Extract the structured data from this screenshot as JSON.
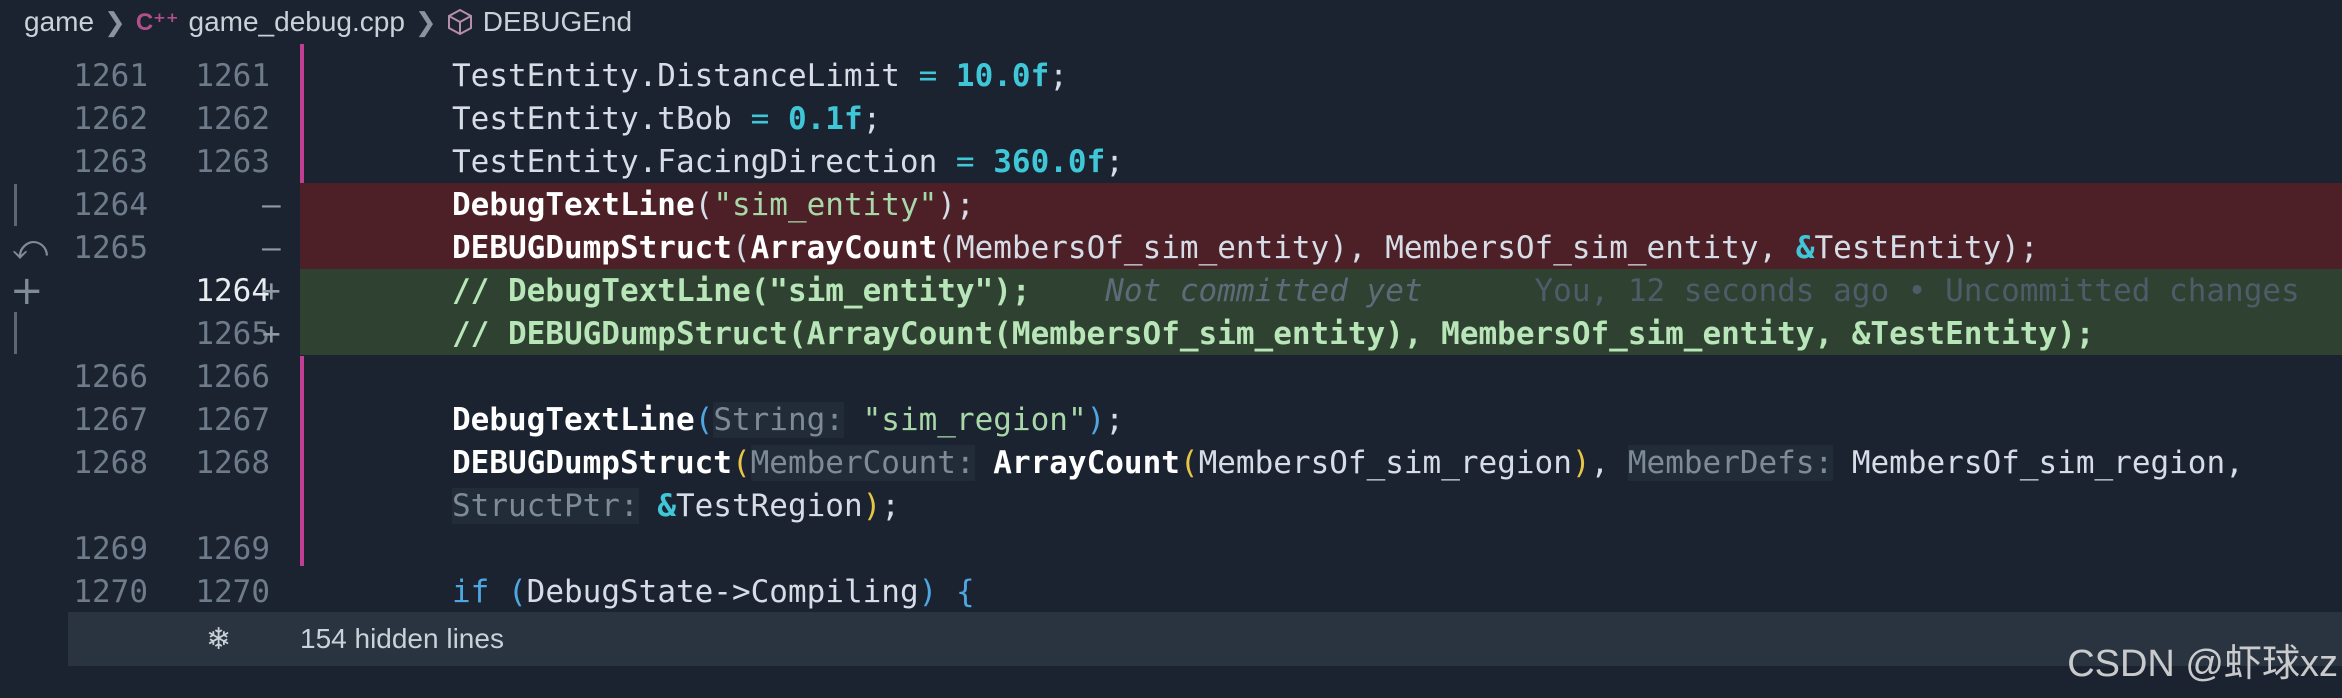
{
  "breadcrumb": {
    "items": [
      "game",
      "game_debug.cpp",
      "DEBUGEnd"
    ],
    "separator": ">"
  },
  "lines": [
    {
      "old": "1261",
      "new": "1261",
      "mark": "",
      "type": "ctx"
    },
    {
      "old": "1262",
      "new": "1262",
      "mark": "",
      "type": "ctx"
    },
    {
      "old": "1263",
      "new": "1263",
      "mark": "",
      "type": "ctx"
    },
    {
      "old": "1264",
      "new": "",
      "mark": "—",
      "type": "removed"
    },
    {
      "old": "1265",
      "new": "",
      "mark": "—",
      "type": "removed"
    },
    {
      "old": "",
      "new": "1264",
      "mark": "+",
      "type": "added"
    },
    {
      "old": "",
      "new": "1265",
      "mark": "+",
      "type": "added"
    },
    {
      "old": "1266",
      "new": "1266",
      "mark": "",
      "type": "ctx"
    },
    {
      "old": "1267",
      "new": "1267",
      "mark": "",
      "type": "ctx"
    },
    {
      "old": "1268",
      "new": "1268",
      "mark": "",
      "type": "ctx"
    },
    {
      "old": "",
      "new": "",
      "mark": "",
      "type": "wrap"
    },
    {
      "old": "1269",
      "new": "1269",
      "mark": "",
      "type": "ctx"
    },
    {
      "old": "1270",
      "new": "1270",
      "mark": "",
      "type": "ctx"
    }
  ],
  "code": {
    "l1261_a": "TestEntity.DistanceLimit ",
    "l1261_op": "= ",
    "l1261_num": "10.0f",
    "l1262_a": "TestEntity.tBob ",
    "l1262_op": "= ",
    "l1262_num": "0.1f",
    "l1263_a": "TestEntity.FacingDirection ",
    "l1263_op": "= ",
    "l1263_num": "360.0f",
    "l1264_fn": "DebugTextLine",
    "l1264_str": "\"sim_entity\"",
    "l1265_fn": "DEBUGDumpStruct",
    "l1265_fn2": "ArrayCount",
    "l1265_a1": "MembersOf_sim_entity",
    "l1265_a2": "MembersOf_sim_entity",
    "l1265_a3": "TestEntity",
    "add1": "// DebugTextLine(\"sim_entity\");",
    "blame_a": "Not committed yet",
    "blame_b": "You, 12 seconds ago • Uncommitted changes",
    "add2": "// DEBUGDumpStruct(ArrayCount(MembersOf_sim_entity), MembersOf_sim_entity, &TestEntity);",
    "l1267_fn": "DebugTextLine",
    "l1267_hint": "String:",
    "l1267_str": "\"sim_region\"",
    "l1268_fn": "DEBUGDumpStruct",
    "l1268_hint1": "MemberCount:",
    "l1268_fn2": "ArrayCount",
    "l1268_a1": "MembersOf_sim_region",
    "l1268_hint2": "MemberDefs:",
    "l1268_a2": "MembersOf_sim_region,",
    "l1268b_hint": "StructPtr:",
    "l1268b_a": "TestRegion",
    "l1270_kw": "if",
    "l1270_a": "DebugState->Compiling"
  },
  "hidden": {
    "label": "154 hidden lines",
    "icon": "snowflake-icon"
  },
  "watermark": "CSDN @虾球xz",
  "colors": {
    "background": "#1b2330",
    "removed": "#4d2027",
    "added": "#2f4131",
    "keyword": "#4fa7e2",
    "number": "#3fc7d8",
    "string": "#a8d8a8",
    "modified_bar": "#c03f93"
  }
}
